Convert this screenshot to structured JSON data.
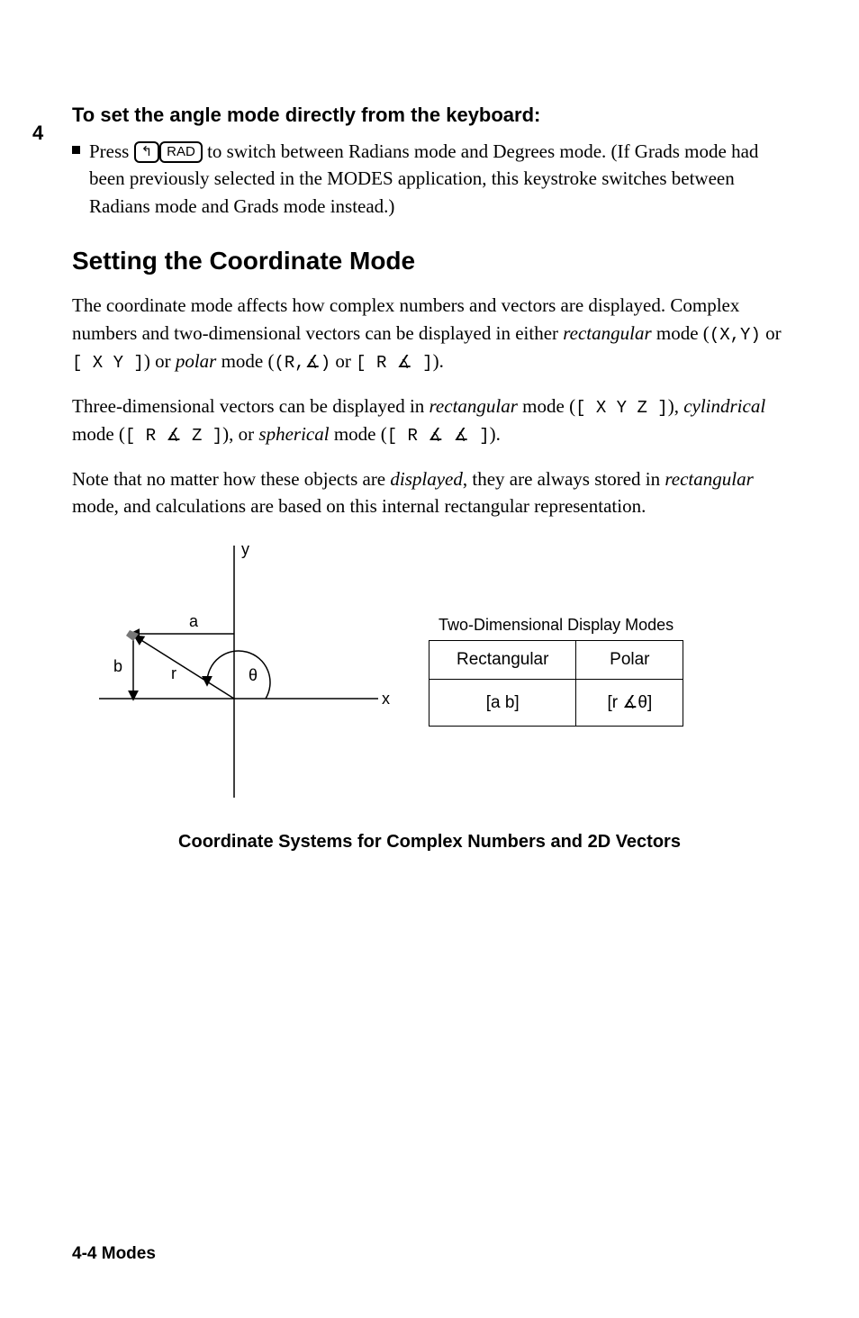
{
  "section_number": "4",
  "subhead": "To set the angle mode directly from the keyboard:",
  "bullet": {
    "text_before": "Press",
    "key_shift_glyph": "↰",
    "key_rad": "RAD",
    "text_after": "to switch between Radians mode and Degrees mode. (If Grads mode had been previously selected in the MODES application, this keystroke switches between Radians mode and Grads mode instead.)"
  },
  "heading": "Setting the Coordinate Mode",
  "para1_a": "The coordinate mode affects how complex numbers and vectors are displayed. Complex numbers and two-dimensional vectors can be displayed in either ",
  "para1_rect": "rectangular",
  "para1_b": " mode (",
  "para1_notation1": "(X,Y)",
  "para1_or1": " or ",
  "para1_notation2": "[ X Y ]",
  "para1_c": ") or ",
  "para1_polar": "polar",
  "para1_d": " mode (",
  "para1_notation3": "(R,∡)",
  "para1_or2": " or ",
  "para1_notation4": "[ R ∡ ]",
  "para1_e": ").",
  "para2_a": "Three-dimensional vectors can be displayed in ",
  "para2_rect": "rectangular",
  "para2_b": " mode (",
  "para2_n1": "[ X Y Z ]",
  "para2_c": "), ",
  "para2_cyl": "cylindrical",
  "para2_d": " mode (",
  "para2_n2": "[ R ∡ Z ]",
  "para2_e": "), or ",
  "para2_sph": "spherical",
  "para2_f": " mode (",
  "para2_n3": "[ R ∡ ∡ ]",
  "para2_g": ").",
  "para3_a": "Note that no matter how these objects are ",
  "para3_disp": "displayed",
  "para3_b": ", they are always stored in ",
  "para3_rect": "rectangular",
  "para3_c": " mode, and calculations are based on this internal rectangular representation.",
  "diagram": {
    "y_label": "y",
    "x_label": "x",
    "a_label": "a",
    "b_label": "b",
    "r_label": "r",
    "theta_label": "θ"
  },
  "table": {
    "caption": "Two-Dimensional Display Modes",
    "headers": [
      "Rectangular",
      "Polar"
    ],
    "cells": [
      "[a b]",
      "[r  ∡θ]"
    ]
  },
  "figure_caption": "Coordinate Systems for Complex Numbers and 2D Vectors",
  "footer": "4-4   Modes"
}
